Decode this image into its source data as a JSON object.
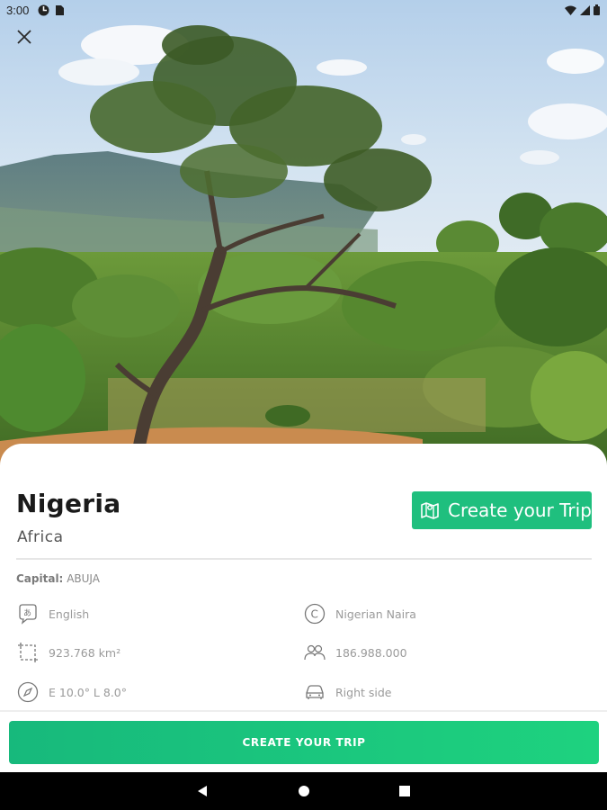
{
  "status_bar": {
    "time": "3:00",
    "left_icons": [
      "data-saver-icon",
      "sim-card-icon"
    ],
    "right_icons": [
      "wifi-icon",
      "signal-icon",
      "battery-icon"
    ]
  },
  "hero": {
    "image": "savanna-tree-landscape-photo",
    "close_icon": "close-icon"
  },
  "country": {
    "name": "Nigeria",
    "continent": "Africa"
  },
  "header_button": {
    "label": "Create your Trip",
    "icon": "map-icon"
  },
  "capital": {
    "label": "Capital:",
    "value": "ABUJA"
  },
  "info": {
    "language": {
      "icon": "language-icon",
      "value": "English"
    },
    "currency": {
      "icon": "currency-icon",
      "value": "Nigerian Naira"
    },
    "area": {
      "icon": "area-icon",
      "value": "923.768 km²"
    },
    "population": {
      "icon": "population-icon",
      "value": "186.988.000"
    },
    "coordinates": {
      "icon": "compass-icon",
      "value": "E 10.0° L 8.0°"
    },
    "driving_side": {
      "icon": "car-icon",
      "value": "Right side"
    }
  },
  "bottom_button": {
    "label": "CREATE YOUR TRIP"
  },
  "colors": {
    "accent": "#1fbf7e",
    "text_primary": "#1a1a1a",
    "text_secondary": "#9a9a9a"
  }
}
